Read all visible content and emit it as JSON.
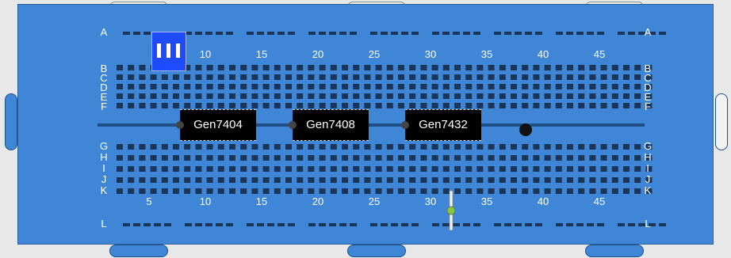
{
  "breadboard": {
    "top_row_letters": [
      "A",
      "B",
      "C",
      "D",
      "E",
      "F"
    ],
    "bottom_row_letters": [
      "G",
      "H",
      "I",
      "J",
      "K"
    ],
    "power_row_top": "A",
    "power_row_bottom": "L",
    "top_column_numbers": [
      "10",
      "15",
      "20",
      "25",
      "30",
      "35",
      "40",
      "45"
    ],
    "bottom_column_numbers": [
      "5",
      "10",
      "15",
      "20",
      "25",
      "30",
      "35",
      "40",
      "45"
    ]
  },
  "chips": [
    {
      "label": "Gen7404"
    },
    {
      "label": "Gen7408"
    },
    {
      "label": "Gen7432"
    }
  ],
  "colors": {
    "board": "#3f86d6",
    "chip": "#000000",
    "dip_switch": "#1f4bff",
    "led": "#8bc34a"
  },
  "icons": {
    "dip_switch": "dip-switch-icon",
    "led": "led-icon",
    "probe": "probe-icon"
  }
}
